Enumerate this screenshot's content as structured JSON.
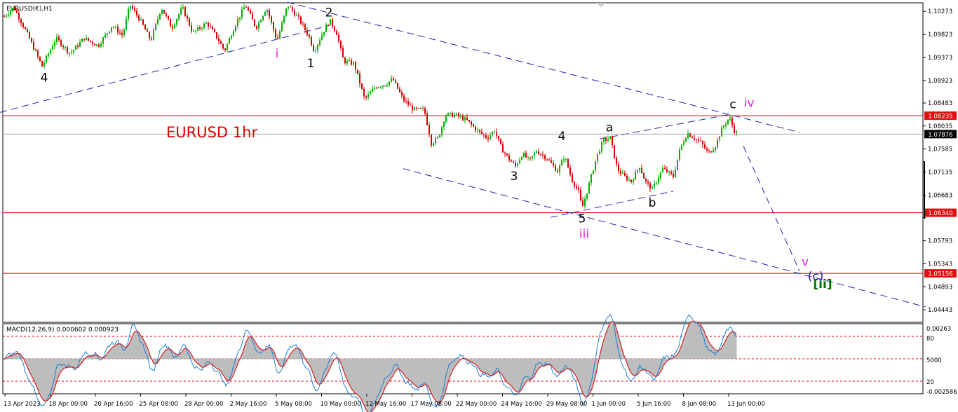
{
  "header": {
    "symbol_title": "EURUSD(€),H1",
    "chart_caption": "EURUSD 1hr",
    "macd_title": "MACD(12,26,9) 0.000602 0.000923"
  },
  "colors": {
    "bull": "#00b000",
    "bear": "#d40000",
    "level_line": "#e00000",
    "channel": "#2020b0",
    "macd_line": "#1e7fd6",
    "macd_signal": "#d02020",
    "macd_hist": "#bdbdbd",
    "magenta": "#e020e0",
    "green": "#007000",
    "price_box": "#e01010"
  },
  "chart_data": {
    "type": "candlestick",
    "symbol": "EURUSD",
    "timeframe": "H1",
    "ylim": [
      1.042,
      1.1044
    ],
    "price_ticks": [
      "1.10273",
      "1.09823",
      "1.09373",
      "1.08923",
      "1.08483",
      "1.08035",
      "1.07585",
      "1.07135",
      "1.06683",
      "1.06243",
      "1.05793",
      "1.05343",
      "1.04893",
      "1.04443"
    ],
    "time_ticks": [
      "13 Apr 2023",
      "18 Apr 00:00",
      "20 Apr 16:00",
      "25 Apr 08:00",
      "28 Apr 00:00",
      "2 May 16:00",
      "5 May 08:00",
      "10 May 00:00",
      "12 May 16:00",
      "17 May 08:00",
      "22 May 00:00",
      "24 May 16:00",
      "29 May 08:00",
      "1 Jun 00:00",
      "5 Jun 16:00",
      "8 Jun 08:00",
      "13 Jun 00:00"
    ],
    "current_price": "1.07876",
    "horizontal_levels": [
      {
        "label": "1.08235",
        "value": 1.08235
      },
      {
        "label": "1.06340",
        "value": 1.0634
      },
      {
        "label": "1.05156",
        "value": 1.05156
      }
    ],
    "price_path": [
      [
        0,
        1.101
      ],
      [
        20,
        1.1035
      ],
      [
        40,
        1.098
      ],
      [
        60,
        1.092
      ],
      [
        80,
        1.0975
      ],
      [
        100,
        1.0945
      ],
      [
        120,
        1.0975
      ],
      [
        140,
        1.096
      ],
      [
        160,
        1.1
      ],
      [
        175,
        1.098
      ],
      [
        185,
        1.104
      ],
      [
        200,
        1.101
      ],
      [
        215,
        1.097
      ],
      [
        230,
        1.1035
      ],
      [
        245,
        1.0995
      ],
      [
        260,
        1.1035
      ],
      [
        275,
        1.0985
      ],
      [
        295,
        1.1005
      ],
      [
        310,
        1.0975
      ],
      [
        320,
        1.095
      ],
      [
        335,
        1.1
      ],
      [
        350,
        1.104
      ],
      [
        365,
        1.0995
      ],
      [
        380,
        1.1035
      ],
      [
        395,
        1.097
      ],
      [
        410,
        1.104
      ],
      [
        425,
        1.1015
      ],
      [
        440,
        1.098
      ],
      [
        448,
        1.095
      ],
      [
        460,
        1.0985
      ],
      [
        470,
        1.101
      ],
      [
        480,
        1.0985
      ],
      [
        490,
        1.093
      ],
      [
        505,
        1.0925
      ],
      [
        520,
        1.0855
      ],
      [
        535,
        1.088
      ],
      [
        550,
        1.0885
      ],
      [
        560,
        1.0895
      ],
      [
        575,
        1.0855
      ],
      [
        590,
        1.0835
      ],
      [
        605,
        1.0835
      ],
      [
        615,
        1.077
      ],
      [
        625,
        1.078
      ],
      [
        635,
        1.0825
      ],
      [
        650,
        1.0825
      ],
      [
        665,
        1.0815
      ],
      [
        680,
        1.0795
      ],
      [
        695,
        1.078
      ],
      [
        705,
        1.0795
      ],
      [
        715,
        1.076
      ],
      [
        725,
        1.074
      ],
      [
        735,
        1.0725
      ],
      [
        745,
        1.075
      ],
      [
        755,
        1.0735
      ],
      [
        765,
        1.0755
      ],
      [
        780,
        1.074
      ],
      [
        795,
        1.0715
      ],
      [
        805,
        1.0745
      ],
      [
        815,
        1.07
      ],
      [
        825,
        1.0675
      ],
      [
        830,
        1.0642
      ],
      [
        840,
        1.069
      ],
      [
        850,
        1.074
      ],
      [
        860,
        1.0775
      ],
      [
        870,
        1.078
      ],
      [
        880,
        1.072
      ],
      [
        890,
        1.0705
      ],
      [
        900,
        1.0695
      ],
      [
        912,
        1.0725
      ],
      [
        920,
        1.0695
      ],
      [
        930,
        1.068
      ],
      [
        945,
        1.072
      ],
      [
        960,
        1.0705
      ],
      [
        970,
        1.076
      ],
      [
        980,
        1.079
      ],
      [
        990,
        1.078
      ],
      [
        1000,
        1.077
      ],
      [
        1010,
        1.075
      ],
      [
        1020,
        1.0765
      ],
      [
        1030,
        1.08
      ],
      [
        1040,
        1.082
      ],
      [
        1048,
        1.079
      ]
    ],
    "channels": [
      {
        "from": [
          0,
          1.083
        ],
        "to": [
          470,
          1.1
        ]
      },
      {
        "from": [
          410,
          1.1045
        ],
        "to": [
          1140,
          1.0791
        ]
      },
      {
        "from": [
          575,
          1.072
        ],
        "to": [
          1320,
          1.045
        ]
      },
      {
        "from": [
          785,
          1.0625
        ],
        "to": [
          960,
          1.0676
        ]
      },
      {
        "from": [
          855,
          1.0778
        ],
        "to": [
          1040,
          1.0826
        ]
      },
      {
        "from": [
          1060,
          1.0764
        ],
        "to": [
          1140,
          1.052
        ]
      }
    ],
    "wave_labels": [
      {
        "text": "4",
        "at": [
          63,
          1.089
        ],
        "color": "black"
      },
      {
        "text": "i",
        "at": [
          395,
          1.0937
        ],
        "color": "magenta"
      },
      {
        "text": "1",
        "at": [
          443,
          1.0918
        ],
        "color": "black"
      },
      {
        "text": "2",
        "at": [
          469,
          1.1017
        ],
        "color": "black"
      },
      {
        "text": "3",
        "at": [
          733,
          1.0698
        ],
        "color": "black"
      },
      {
        "text": "4",
        "at": [
          801,
          1.0776
        ],
        "color": "black"
      },
      {
        "text": "a",
        "at": [
          869,
          1.0793
        ],
        "color": "black"
      },
      {
        "text": "5",
        "at": [
          830,
          1.0615
        ],
        "color": "black"
      },
      {
        "text": "iii",
        "at": [
          833,
          1.0585
        ],
        "color": "magenta"
      },
      {
        "text": "b",
        "at": [
          930,
          1.0646
        ],
        "color": "black"
      },
      {
        "text": "c",
        "at": [
          1045,
          1.0838
        ],
        "color": "black"
      },
      {
        "text": "iv",
        "at": [
          1068,
          1.0841
        ],
        "color": "magenta"
      },
      {
        "text": "v",
        "at": [
          1148,
          1.0531
        ],
        "color": "magenta"
      },
      {
        "text": "(c)",
        "at": [
          1163,
          1.0502
        ],
        "color": "blue"
      },
      {
        "text": "[ii]",
        "at": [
          1173,
          1.0487
        ],
        "color": "green"
      }
    ]
  },
  "macd": {
    "title": "MACD(12,26,9) 0.000602 0.000923",
    "ticks": [
      "0.00263",
      "80",
      "5000",
      "20",
      "-0.002586"
    ],
    "range": [
      -0.0026,
      0.0026
    ]
  }
}
